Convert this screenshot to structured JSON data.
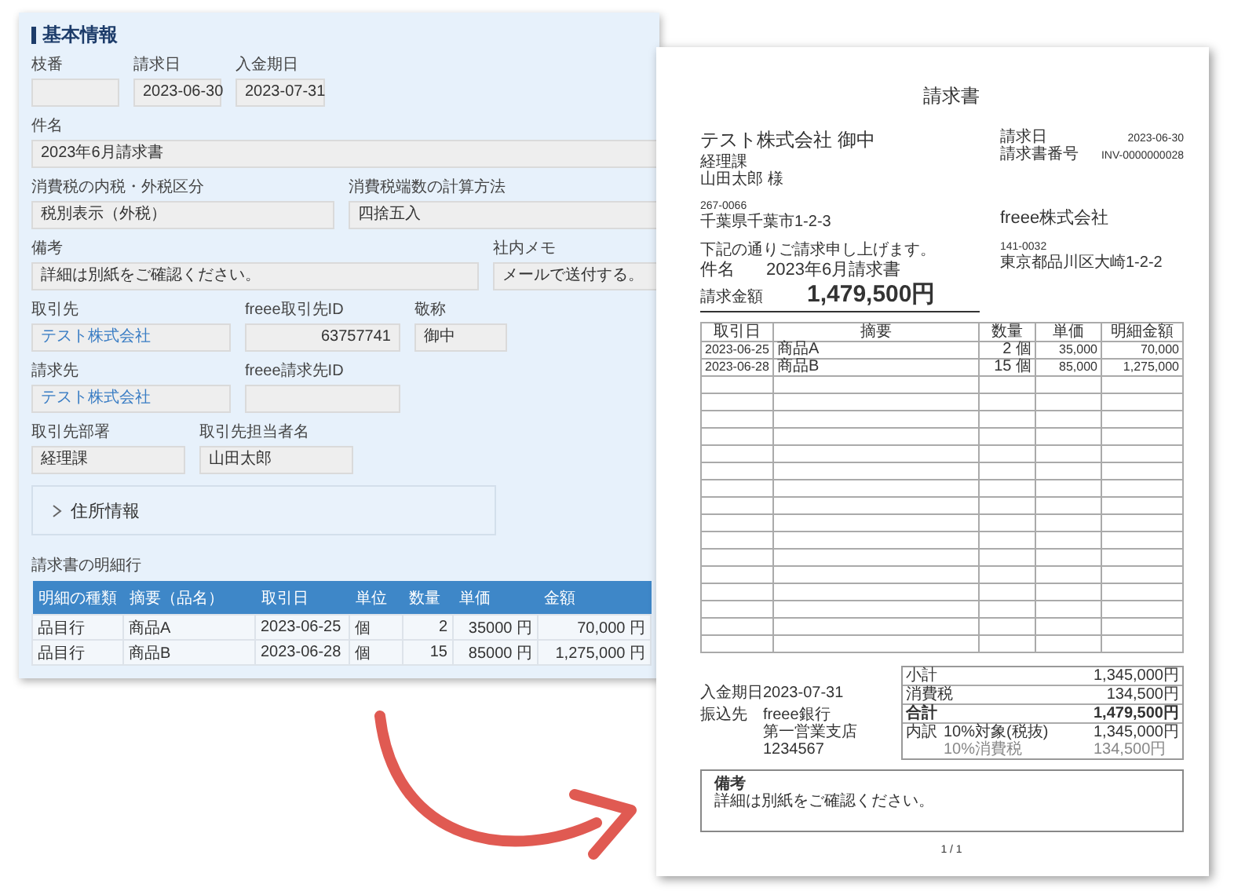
{
  "form": {
    "title": "基本情報",
    "field_rows": [
      [
        {
          "label": "枝番",
          "kind": "text"
        },
        {
          "label": "請求日",
          "value": "2023-06-30",
          "kind": "text"
        },
        {
          "label": "入金期日",
          "value": "2023-07-31",
          "kind": "text"
        }
      ],
      [
        {
          "label": "件名",
          "value": "2023年6月請求書",
          "kind": "text"
        }
      ],
      [
        {
          "label": "消費税の内税・外税区分",
          "value": "税別表示（外税）",
          "kind": "text"
        },
        {
          "label": "消費税端数の計算方法",
          "value": "四捨五入",
          "kind": "text"
        }
      ],
      [
        {
          "label": "備考",
          "value": "詳細は別紙をご確認ください。",
          "kind": "text"
        },
        {
          "label": "社内メモ",
          "value": "メールで送付する。",
          "kind": "text"
        }
      ],
      [
        {
          "label": "取引先",
          "value": "テスト株式会社",
          "kind": "link"
        },
        {
          "label": "freee取引先ID",
          "value": "63757741",
          "kind": "number"
        },
        {
          "label": "敬称",
          "value": "御中",
          "kind": "text"
        }
      ],
      [
        {
          "label": "請求先",
          "value": "テスト株式会社",
          "kind": "link"
        },
        {
          "label": "freee請求先ID",
          "kind": "text"
        }
      ],
      [
        {
          "label": "取引先部署",
          "value": "経理課",
          "kind": "text"
        },
        {
          "label": "取引先担当者名",
          "value": "山田太郎",
          "kind": "text"
        }
      ]
    ],
    "address_section": {
      "label": "住所情報",
      "expanded": false
    },
    "lines": {
      "label": "請求書の明細行",
      "columns": [
        {
          "label": "明細の種類",
          "kind": "text"
        },
        {
          "label": "摘要（品名）",
          "kind": "text"
        },
        {
          "label": "取引日",
          "kind": "text"
        },
        {
          "label": "単位",
          "kind": "text"
        },
        {
          "label": "数量",
          "kind": "number"
        },
        {
          "label": "単価",
          "kind": "number"
        },
        {
          "label": "金額",
          "kind": "number"
        }
      ],
      "rows": [
        [
          "品目行",
          "商品A",
          "2023-06-25",
          "個",
          "2",
          "35000 円",
          "70,000 円"
        ],
        [
          "品目行",
          "商品B",
          "2023-06-28",
          "個",
          "15",
          "85000 円",
          "1,275,000 円"
        ]
      ]
    }
  },
  "invoice": {
    "title": "請求書",
    "recipient": {
      "name": "テスト株式会社 御中",
      "department": "経理課",
      "person": "山田太郎 様",
      "postal": "267-0066",
      "address": "千葉県千葉市1-2-3"
    },
    "meta": [
      {
        "label": "請求日",
        "value": "2023-06-30"
      },
      {
        "label": "請求書番号",
        "value": "INV-0000000028"
      }
    ],
    "issuer": {
      "name": "freee株式会社",
      "postal": "141-0032",
      "address": "東京都品川区大崎1-2-2"
    },
    "greeting": "下記の通りご請求申し上げます。",
    "subject": {
      "label": "件名",
      "value": "2023年6月請求書"
    },
    "amount": {
      "label": "請求金額",
      "value": "1,479,500円"
    },
    "table": {
      "columns": [
        {
          "label": "取引日",
          "kind": "date"
        },
        {
          "label": "摘要",
          "kind": "text"
        },
        {
          "label": "数量",
          "kind": "number"
        },
        {
          "label": "単価",
          "kind": "number"
        },
        {
          "label": "明細金額",
          "kind": "number"
        }
      ],
      "rows": [
        [
          "2023-06-25",
          "商品A",
          "2 個",
          "35,000",
          "70,000"
        ],
        [
          "2023-06-28",
          "商品B",
          "15 個",
          "85,000",
          "1,275,000"
        ]
      ]
    },
    "payment": [
      {
        "label": "入金期日",
        "lines": [
          "2023-07-31"
        ]
      },
      {
        "label": "振込先",
        "lines": [
          "freee銀行",
          "第一営業支店",
          "1234567"
        ]
      }
    ],
    "totals": [
      {
        "label": "小計",
        "value": "1,345,000円",
        "kind": "normal"
      },
      {
        "label": "消費税",
        "value": "134,500円",
        "kind": "normal"
      },
      {
        "label": "合計",
        "value": "1,479,500円",
        "kind": "total"
      }
    ],
    "breakdown": {
      "label": "内訳",
      "rows": [
        {
          "label": "10%対象(税抜)",
          "value": "1,345,000円",
          "kind": "main"
        },
        {
          "label": "10%消費税",
          "value": "134,500円",
          "kind": "sub"
        }
      ]
    },
    "remarks": {
      "label": "備考",
      "text": "詳細は別紙をご確認ください。"
    },
    "page": "1 / 1"
  }
}
